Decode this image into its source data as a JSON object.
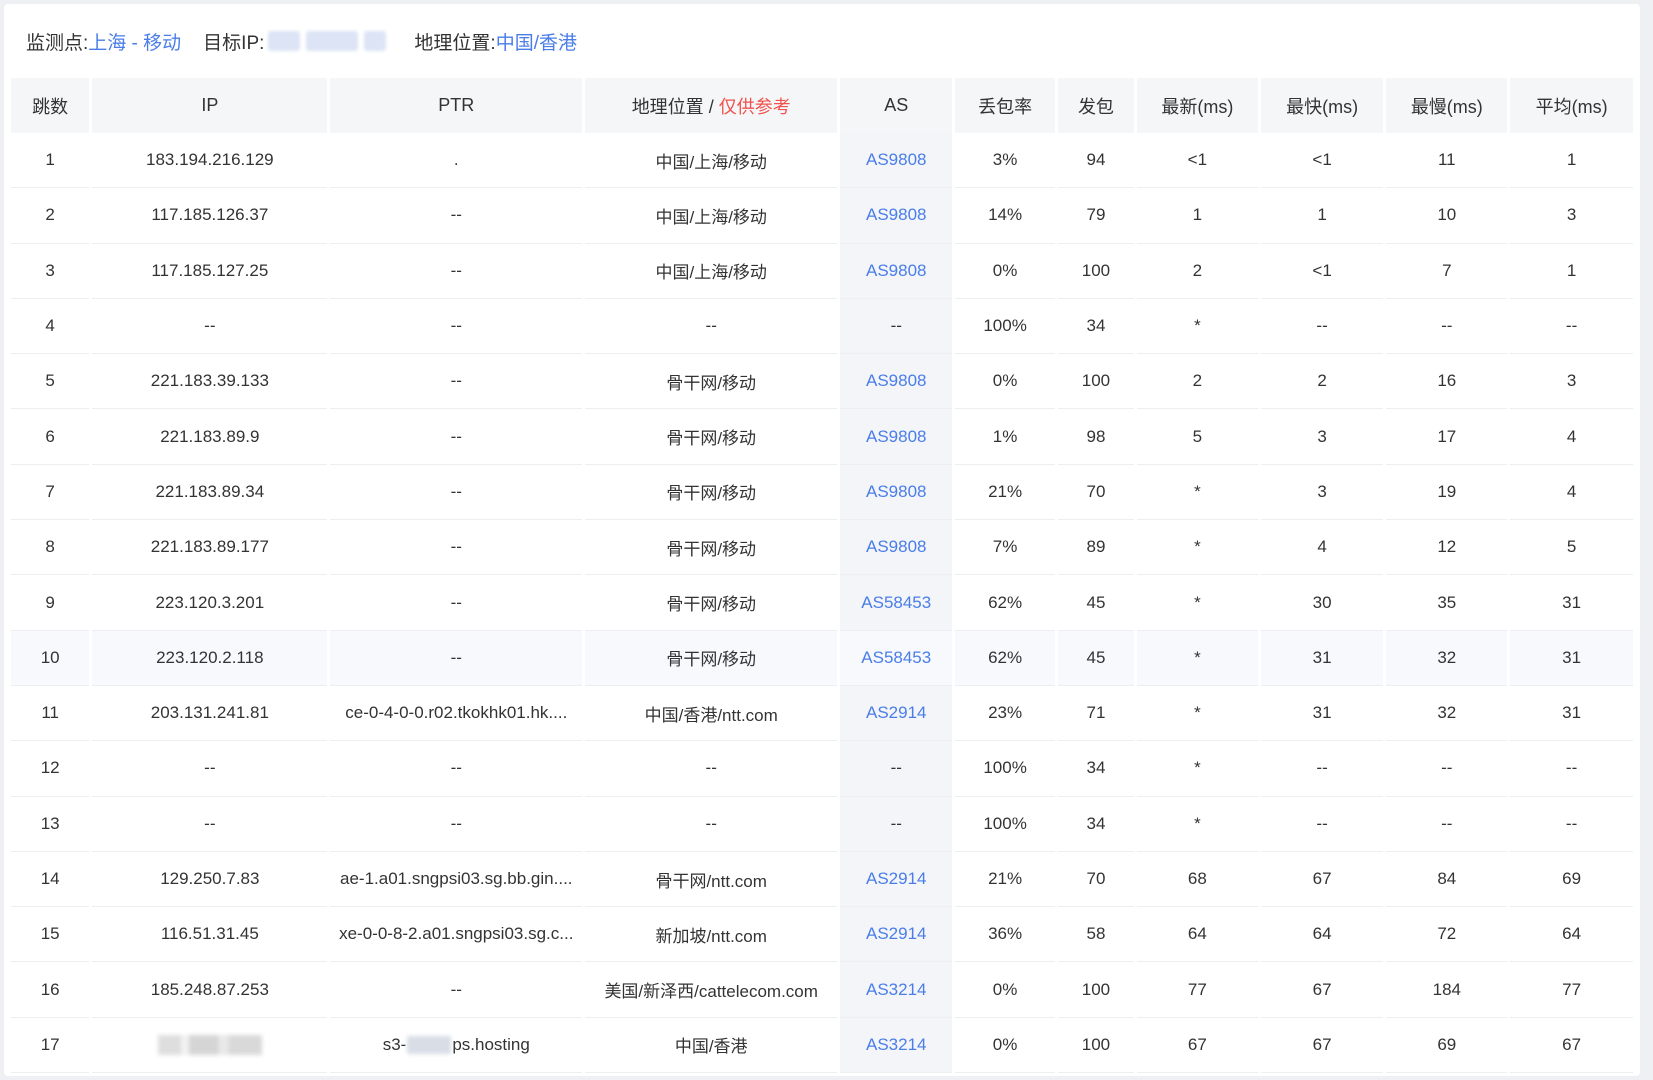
{
  "header": {
    "monitor_label": "监测点:",
    "monitor_value": "上海 - 移动",
    "target_label": "目标IP:",
    "location_label": "地理位置:",
    "location_value": "中国/香港"
  },
  "table": {
    "columns": {
      "hop": "跳数",
      "ip": "IP",
      "ptr": "PTR",
      "geo": "地理位置",
      "geo_sep": " / ",
      "geo_note": "仅供参考",
      "as": "AS",
      "loss": "丢包率",
      "sent": "发包",
      "last": "最新(ms)",
      "best": "最快(ms)",
      "worst": "最慢(ms)",
      "avg": "平均(ms)"
    },
    "rows": [
      {
        "hop": "1",
        "ip": "183.194.216.129",
        "ptr": ".",
        "geo": "中国/上海/移动",
        "as": "AS9808",
        "loss": "3%",
        "sent": "94",
        "last": "<1",
        "best": "<1",
        "worst": "11",
        "avg": "1"
      },
      {
        "hop": "2",
        "ip": "117.185.126.37",
        "ptr": "--",
        "geo": "中国/上海/移动",
        "as": "AS9808",
        "loss": "14%",
        "sent": "79",
        "last": "1",
        "best": "1",
        "worst": "10",
        "avg": "3"
      },
      {
        "hop": "3",
        "ip": "117.185.127.25",
        "ptr": "--",
        "geo": "中国/上海/移动",
        "as": "AS9808",
        "loss": "0%",
        "sent": "100",
        "last": "2",
        "best": "<1",
        "worst": "7",
        "avg": "1"
      },
      {
        "hop": "4",
        "ip": "--",
        "ptr": "--",
        "geo": "--",
        "as": "--",
        "loss": "100%",
        "sent": "34",
        "last": "*",
        "best": "--",
        "worst": "--",
        "avg": "--"
      },
      {
        "hop": "5",
        "ip": "221.183.39.133",
        "ptr": "--",
        "geo": "骨干网/移动",
        "as": "AS9808",
        "loss": "0%",
        "sent": "100",
        "last": "2",
        "best": "2",
        "worst": "16",
        "avg": "3"
      },
      {
        "hop": "6",
        "ip": "221.183.89.9",
        "ptr": "--",
        "geo": "骨干网/移动",
        "as": "AS9808",
        "loss": "1%",
        "sent": "98",
        "last": "5",
        "best": "3",
        "worst": "17",
        "avg": "4"
      },
      {
        "hop": "7",
        "ip": "221.183.89.34",
        "ptr": "--",
        "geo": "骨干网/移动",
        "as": "AS9808",
        "loss": "21%",
        "sent": "70",
        "last": "*",
        "best": "3",
        "worst": "19",
        "avg": "4"
      },
      {
        "hop": "8",
        "ip": "221.183.89.177",
        "ptr": "--",
        "geo": "骨干网/移动",
        "as": "AS9808",
        "loss": "7%",
        "sent": "89",
        "last": "*",
        "best": "4",
        "worst": "12",
        "avg": "5"
      },
      {
        "hop": "9",
        "ip": "223.120.3.201",
        "ptr": "--",
        "geo": "骨干网/移动",
        "as": "AS58453",
        "loss": "62%",
        "sent": "45",
        "last": "*",
        "best": "30",
        "worst": "35",
        "avg": "31"
      },
      {
        "hop": "10",
        "ip": "223.120.2.118",
        "ptr": "--",
        "geo": "骨干网/移动",
        "as": "AS58453",
        "loss": "62%",
        "sent": "45",
        "last": "*",
        "best": "31",
        "worst": "32",
        "avg": "31"
      },
      {
        "hop": "11",
        "ip": "203.131.241.81",
        "ptr": "ce-0-4-0-0.r02.tkokhk01.hk....",
        "geo": "中国/香港/ntt.com",
        "as": "AS2914",
        "loss": "23%",
        "sent": "71",
        "last": "*",
        "best": "31",
        "worst": "32",
        "avg": "31"
      },
      {
        "hop": "12",
        "ip": "--",
        "ptr": "--",
        "geo": "--",
        "as": "--",
        "loss": "100%",
        "sent": "34",
        "last": "*",
        "best": "--",
        "worst": "--",
        "avg": "--"
      },
      {
        "hop": "13",
        "ip": "--",
        "ptr": "--",
        "geo": "--",
        "as": "--",
        "loss": "100%",
        "sent": "34",
        "last": "*",
        "best": "--",
        "worst": "--",
        "avg": "--"
      },
      {
        "hop": "14",
        "ip": "129.250.7.83",
        "ptr": "ae-1.a01.sngpsi03.sg.bb.gin....",
        "geo": "骨干网/ntt.com",
        "as": "AS2914",
        "loss": "21%",
        "sent": "70",
        "last": "68",
        "best": "67",
        "worst": "84",
        "avg": "69"
      },
      {
        "hop": "15",
        "ip": "116.51.31.45",
        "ptr": "xe-0-0-8-2.a01.sngpsi03.sg.c...",
        "geo": "新加坡/ntt.com",
        "as": "AS2914",
        "loss": "36%",
        "sent": "58",
        "last": "64",
        "best": "64",
        "worst": "72",
        "avg": "64"
      },
      {
        "hop": "16",
        "ip": "185.248.87.253",
        "ptr": "--",
        "geo": "美国/新泽西/cattelecom.com",
        "as": "AS3214",
        "loss": "0%",
        "sent": "100",
        "last": "77",
        "best": "67",
        "worst": "184",
        "avg": "77"
      },
      {
        "hop": "17",
        "ip": "",
        "ip_redacted": true,
        "ptr": "s3-",
        "ptr_suffix": "ps.hosting",
        "ptr_redacted": true,
        "geo": "中国/香港",
        "as": "AS3214",
        "loss": "0%",
        "sent": "100",
        "last": "67",
        "best": "67",
        "worst": "69",
        "avg": "67"
      }
    ],
    "highlighted_row": 10
  },
  "colors": {
    "accent": "#4a7de8",
    "warn": "#f0534e",
    "header_bg": "#f5f6f8"
  }
}
